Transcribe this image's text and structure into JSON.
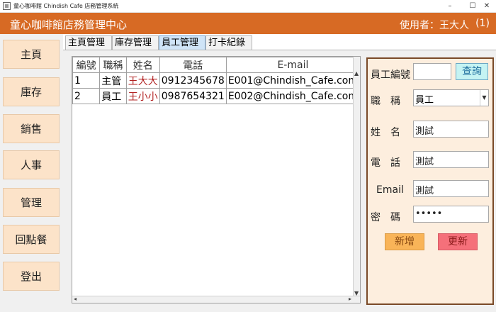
{
  "window": {
    "title": "童心咖啡館 Chindish Cafe 店務管理系統",
    "controls": {
      "minimize": "–",
      "maximize": "☐",
      "close": "✕"
    }
  },
  "header": {
    "app_title": "童心咖啡館店務管理中心",
    "user_label": "使用者：王大人",
    "count": "(1)"
  },
  "nav": {
    "items": [
      {
        "label": "主頁"
      },
      {
        "label": "庫存"
      },
      {
        "label": "銷售"
      },
      {
        "label": "人事"
      },
      {
        "label": "管理"
      },
      {
        "label": "回點餐"
      },
      {
        "label": "登出"
      }
    ]
  },
  "tabs": [
    {
      "label": "主頁管理",
      "active": false
    },
    {
      "label": "庫存管理",
      "active": false
    },
    {
      "label": "員工管理",
      "active": true
    },
    {
      "label": "打卡紀錄",
      "active": false
    }
  ],
  "table": {
    "columns": [
      "編號",
      "職稱",
      "姓名",
      "電話",
      "E-mail"
    ],
    "rows": [
      [
        "1",
        "主管",
        "王大大",
        "0912345678",
        "E001@Chindish_Cafe.com"
      ],
      [
        "2",
        "員工",
        "王小小",
        "0987654321",
        "E002@Chindish_Cafe.com"
      ]
    ]
  },
  "form": {
    "employee_id_label": "員工編號",
    "employee_id_value": "",
    "query_button": "查詢",
    "title_label": "職　稱",
    "title_value": "員工",
    "name_label": "姓　名",
    "name_value": "測試",
    "phone_label": "電　話",
    "phone_value": "測試",
    "email_label": "Email",
    "email_value": "測試",
    "password_label": "密　碼",
    "password_value": "•••••",
    "add_button": "新增",
    "update_button": "更新"
  },
  "colors": {
    "header_bg": "#d76a24",
    "nav_button_bg": "#fce3c9",
    "form_bg": "#fdeede",
    "form_border": "#7a4a28",
    "query_button": "#c5f3f3",
    "add_button": "#f9b458",
    "update_button": "#f5707a",
    "name_text": "#b22222"
  }
}
